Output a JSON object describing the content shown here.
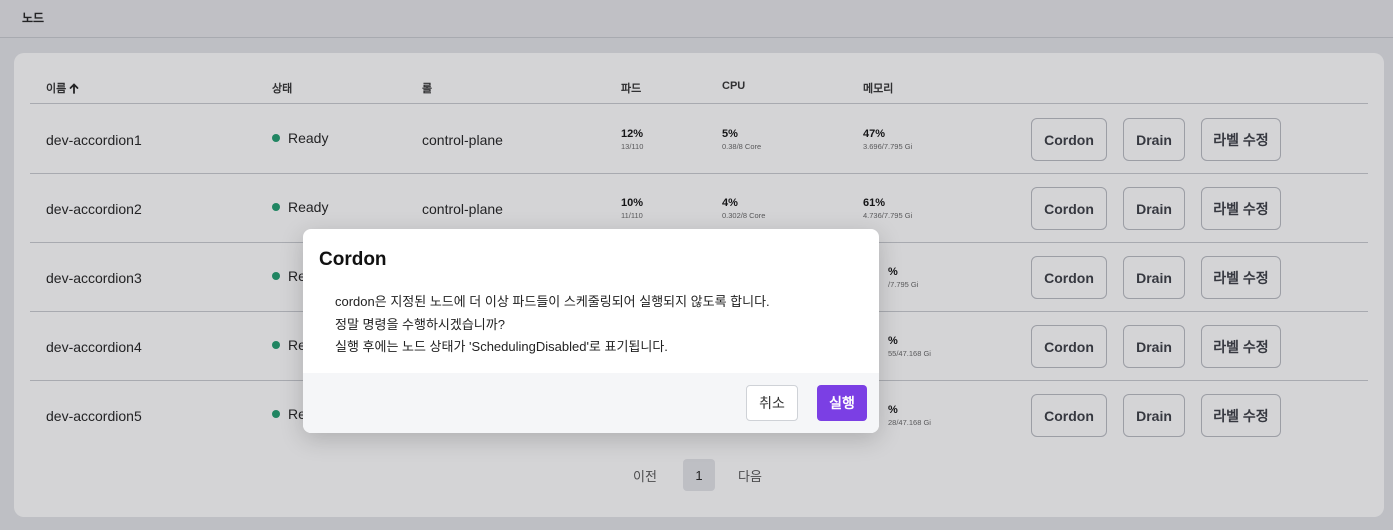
{
  "page": {
    "title": "노드"
  },
  "table": {
    "columns": {
      "name": "이름",
      "sort_icon": "arrow-up-icon",
      "status": "상태",
      "role": "롤",
      "pods": "파드",
      "cpu": "CPU",
      "memory": "메모리"
    },
    "rows": [
      {
        "name": "dev-accordion1",
        "status": "Ready",
        "role": "control-plane",
        "pods_pct": "12%",
        "pods_sub": "13/110",
        "cpu_pct": "5%",
        "cpu_sub": "0.38/8 Core",
        "mem_pct": "47%",
        "mem_sub": "3.696/7.795 Gi"
      },
      {
        "name": "dev-accordion2",
        "status": "Ready",
        "role": "control-plane",
        "pods_pct": "10%",
        "pods_sub": "11/110",
        "cpu_pct": "4%",
        "cpu_sub": "0.302/8 Core",
        "mem_pct": "61%",
        "mem_sub": "4.736/7.795 Gi"
      },
      {
        "name": "dev-accordion3",
        "status": "Re",
        "mem_pct": "%",
        "mem_sub": "/7.795 Gi"
      },
      {
        "name": "dev-accordion4",
        "status": "Re",
        "mem_pct": "%",
        "mem_sub": "55/47.168 Gi"
      },
      {
        "name": "dev-accordion5",
        "status": "Re",
        "mem_pct": "%",
        "mem_sub": "28/47.168 Gi"
      }
    ],
    "actions": {
      "cordon": "Cordon",
      "drain": "Drain",
      "edit_labels": "라벨 수정"
    },
    "status_color": "#1f9d6e"
  },
  "pagination": {
    "prev": "이전",
    "current": "1",
    "next": "다음"
  },
  "modal": {
    "title": "Cordon",
    "lines": [
      "cordon은 지정된 노드에 더 이상 파드들이 스케줄링되어 실행되지 않도록 합니다.",
      "정말 명령을 수행하시겠습니까?",
      "실행 후에는 노드 상태가 'SchedulingDisabled'로 표기됩니다."
    ],
    "cancel": "취소",
    "confirm": "실행",
    "confirm_color": "#7b3fe4"
  }
}
